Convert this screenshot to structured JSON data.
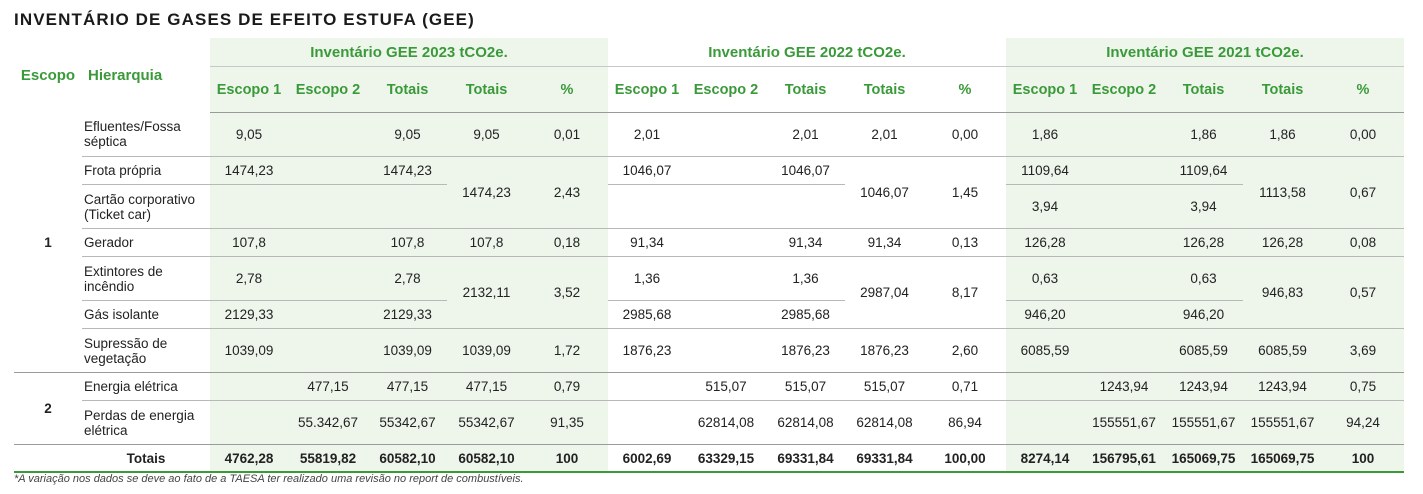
{
  "title": "INVENTÁRIO DE GASES DE EFEITO ESTUFA (GEE)",
  "headers": {
    "escopo": "Escopo",
    "hierarquia": "Hierarquia",
    "y2023": "Inventário GEE 2023 tCO2e.",
    "y2022": "Inventário GEE 2022 tCO2e.",
    "y2021": "Inventário GEE 2021 tCO2e.",
    "escopo1": "Escopo 1",
    "escopo2": "Escopo 2",
    "totais": "Totais",
    "pct": "%"
  },
  "scope_labels": {
    "s1": "1",
    "s2": "2"
  },
  "rows": {
    "efluentes": {
      "label": "Efluentes/Fossa séptica",
      "y2023": [
        "9,05",
        "",
        "9,05",
        "9,05",
        "0,01"
      ],
      "y2022": [
        "2,01",
        "",
        "2,01",
        "2,01",
        "0,00"
      ],
      "y2021": [
        "1,86",
        "",
        "1,86",
        "1,86",
        "0,00"
      ]
    },
    "frota": {
      "label": "Frota própria",
      "y2023": [
        "1474,23",
        "",
        "1474,23"
      ],
      "y2022": [
        "1046,07",
        "",
        "1046,07"
      ],
      "y2021": [
        "1109,64",
        "",
        "1109,64"
      ]
    },
    "cartao": {
      "label": "Cartão corporativo (Ticket car)",
      "y2023": [
        "",
        "",
        ""
      ],
      "y2022": [
        "",
        "",
        ""
      ],
      "y2021": [
        "3,94",
        "",
        "3,94"
      ]
    },
    "frota_cartao_group": {
      "y2023": [
        "1474,23",
        "2,43"
      ],
      "y2022": [
        "1046,07",
        "1,45"
      ],
      "y2021": [
        "1113,58",
        "0,67"
      ]
    },
    "gerador": {
      "label": "Gerador",
      "y2023": [
        "107,8",
        "",
        "107,8",
        "107,8",
        "0,18"
      ],
      "y2022": [
        "91,34",
        "",
        "91,34",
        "91,34",
        "0,13"
      ],
      "y2021": [
        "126,28",
        "",
        "126,28",
        "126,28",
        "0,08"
      ]
    },
    "extintores": {
      "label": "Extintores de incêndio",
      "y2023": [
        "2,78",
        "",
        "2,78"
      ],
      "y2022": [
        "1,36",
        "",
        "1,36"
      ],
      "y2021": [
        "0,63",
        "",
        "0,63"
      ]
    },
    "gas": {
      "label": "Gás isolante",
      "y2023": [
        "2129,33",
        "",
        "2129,33"
      ],
      "y2022": [
        "2985,68",
        "",
        "2985,68"
      ],
      "y2021": [
        "946,20",
        "",
        "946,20"
      ]
    },
    "ext_gas_group": {
      "y2023": [
        "2132,11",
        "3,52"
      ],
      "y2022": [
        "2987,04",
        "8,17"
      ],
      "y2021": [
        "946,83",
        "0,57"
      ]
    },
    "supressao": {
      "label": "Supressão de vegetação",
      "y2023": [
        "1039,09",
        "",
        "1039,09",
        "1039,09",
        "1,72"
      ],
      "y2022": [
        "1876,23",
        "",
        "1876,23",
        "1876,23",
        "2,60"
      ],
      "y2021": [
        "6085,59",
        "",
        "6085,59",
        "6085,59",
        "3,69"
      ]
    },
    "energia": {
      "label": "Energia elétrica",
      "y2023": [
        "",
        "477,15",
        "477,15",
        "477,15",
        "0,79"
      ],
      "y2022": [
        "",
        "515,07",
        "515,07",
        "515,07",
        "0,71"
      ],
      "y2021": [
        "",
        "1243,94",
        "1243,94",
        "1243,94",
        "0,75"
      ]
    },
    "perdas": {
      "label": "Perdas de energia elétrica",
      "y2023": [
        "",
        "55.342,67",
        "55342,67",
        "55342,67",
        "91,35"
      ],
      "y2022": [
        "",
        "62814,08",
        "62814,08",
        "62814,08",
        "86,94"
      ],
      "y2021": [
        "",
        "155551,67",
        "155551,67",
        "155551,67",
        "94,24"
      ]
    },
    "totais": {
      "label": "Totais",
      "y2023": [
        "4762,28",
        "55819,82",
        "60582,10",
        "60582,10",
        "100"
      ],
      "y2022": [
        "6002,69",
        "63329,15",
        "69331,84",
        "69331,84",
        "100,00"
      ],
      "y2021": [
        "8274,14",
        "156795,61",
        "165069,75",
        "165069,75",
        "100"
      ]
    }
  },
  "footnote": "*A variação nos dados se deve ao fato de a TAESA ter realizado uma revisão no report de combustíveis.",
  "colors": {
    "accent_green": "#3a9a3a",
    "band_green": "#eef6ec"
  }
}
